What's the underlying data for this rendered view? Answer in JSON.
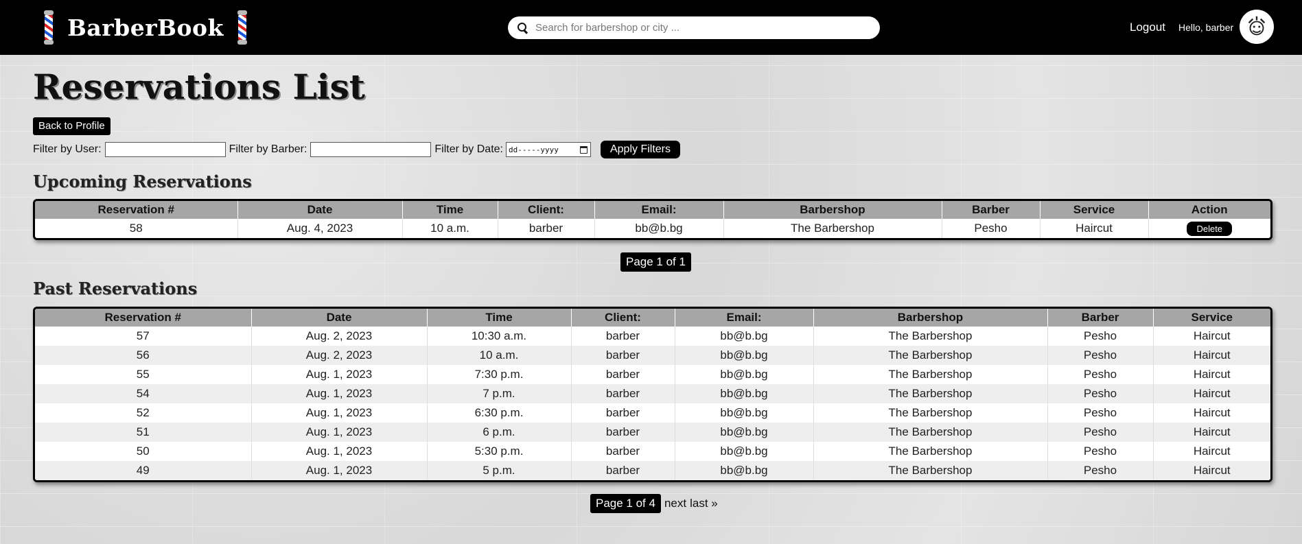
{
  "header": {
    "brand": "BarberBook",
    "search_placeholder": "Search for barbershop or city ...",
    "logout": "Logout",
    "greeting": "Hello, barber"
  },
  "page": {
    "title": "Reservations List",
    "back_button": "Back to Profile"
  },
  "filters": {
    "user_label": "Filter by User:",
    "barber_label": "Filter by Barber:",
    "date_label": "Filter by Date:",
    "date_placeholder": "dd-----yyyy",
    "apply": "Apply Filters"
  },
  "upcoming": {
    "title": "Upcoming Reservations",
    "columns": [
      "Reservation #",
      "Date",
      "Time",
      "Client:",
      "Email:",
      "Barbershop",
      "Barber",
      "Service",
      "Action"
    ],
    "rows": [
      [
        "58",
        "Aug. 4, 2023",
        "10 a.m.",
        "barber",
        "bb@b.bg",
        "The Barbershop",
        "Pesho",
        "Haircut"
      ]
    ],
    "action_label": "Delete",
    "pager": "Page 1 of 1"
  },
  "past": {
    "title": "Past Reservations",
    "columns": [
      "Reservation #",
      "Date",
      "Time",
      "Client:",
      "Email:",
      "Barbershop",
      "Barber",
      "Service"
    ],
    "rows": [
      [
        "57",
        "Aug. 2, 2023",
        "10:30 a.m.",
        "barber",
        "bb@b.bg",
        "The Barbershop",
        "Pesho",
        "Haircut"
      ],
      [
        "56",
        "Aug. 2, 2023",
        "10 a.m.",
        "barber",
        "bb@b.bg",
        "The Barbershop",
        "Pesho",
        "Haircut"
      ],
      [
        "55",
        "Aug. 1, 2023",
        "7:30 p.m.",
        "barber",
        "bb@b.bg",
        "The Barbershop",
        "Pesho",
        "Haircut"
      ],
      [
        "54",
        "Aug. 1, 2023",
        "7 p.m.",
        "barber",
        "bb@b.bg",
        "The Barbershop",
        "Pesho",
        "Haircut"
      ],
      [
        "52",
        "Aug. 1, 2023",
        "6:30 p.m.",
        "barber",
        "bb@b.bg",
        "The Barbershop",
        "Pesho",
        "Haircut"
      ],
      [
        "51",
        "Aug. 1, 2023",
        "6 p.m.",
        "barber",
        "bb@b.bg",
        "The Barbershop",
        "Pesho",
        "Haircut"
      ],
      [
        "50",
        "Aug. 1, 2023",
        "5:30 p.m.",
        "barber",
        "bb@b.bg",
        "The Barbershop",
        "Pesho",
        "Haircut"
      ],
      [
        "49",
        "Aug. 1, 2023",
        "5 p.m.",
        "barber",
        "bb@b.bg",
        "The Barbershop",
        "Pesho",
        "Haircut"
      ]
    ],
    "pager": "Page 1 of 4",
    "next": "next",
    "last": "last »"
  }
}
